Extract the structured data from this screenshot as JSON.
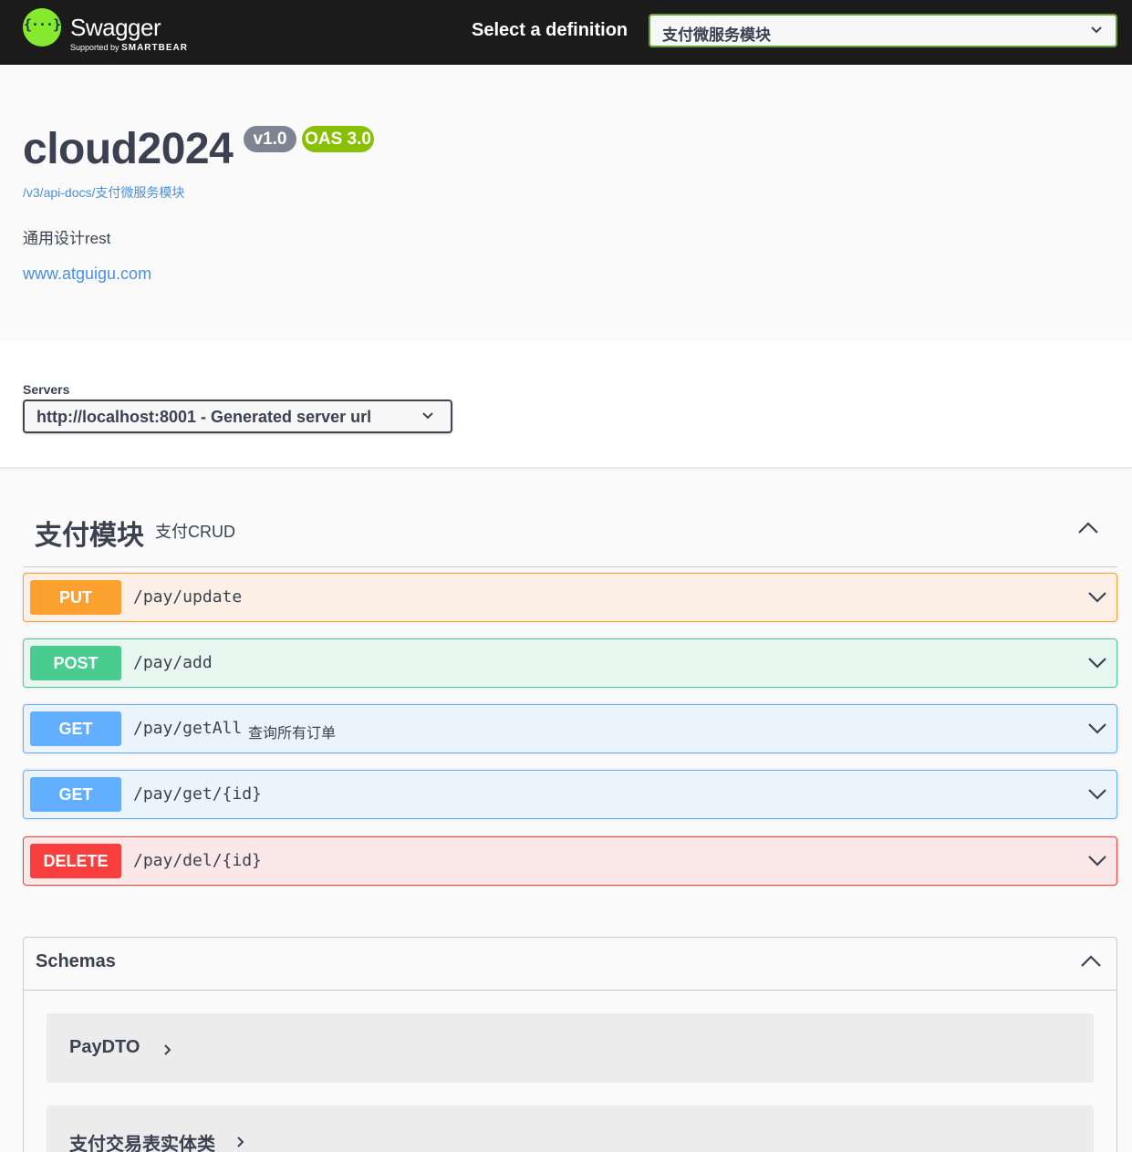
{
  "topbar": {
    "logo_name": "Swagger",
    "logo_sub_prefix": "Supported by",
    "logo_sub_brand": "SMARTBEAR",
    "definition_label": "Select a definition",
    "definition_selected": "支付微服务模块"
  },
  "info": {
    "title": "cloud2024",
    "version": "v1.0",
    "oas": "OAS 3.0",
    "url": "/v3/api-docs/支付微服务模块",
    "description": "通用设计rest",
    "link": "www.atguigu.com"
  },
  "servers": {
    "label": "Servers",
    "selected": "http://localhost:8001 - Generated server url"
  },
  "tag": {
    "name": "支付模块",
    "description": "支付CRUD"
  },
  "operations": [
    {
      "method": "PUT",
      "path": "/pay/update",
      "summary": ""
    },
    {
      "method": "POST",
      "path": "/pay/add",
      "summary": ""
    },
    {
      "method": "GET",
      "path": "/pay/getAll",
      "summary": "查询所有订单"
    },
    {
      "method": "GET",
      "path": "/pay/get/{id}",
      "summary": ""
    },
    {
      "method": "DELETE",
      "path": "/pay/del/{id}",
      "summary": ""
    }
  ],
  "schemas": {
    "title": "Schemas",
    "models": [
      "PayDTO",
      "支付交易表实体类"
    ]
  },
  "colors": {
    "put": "#fca130",
    "post": "#49cc90",
    "get": "#61affe",
    "delete": "#f93e3e",
    "link": "#4990e2",
    "swagger_green": "#85ea2d"
  }
}
